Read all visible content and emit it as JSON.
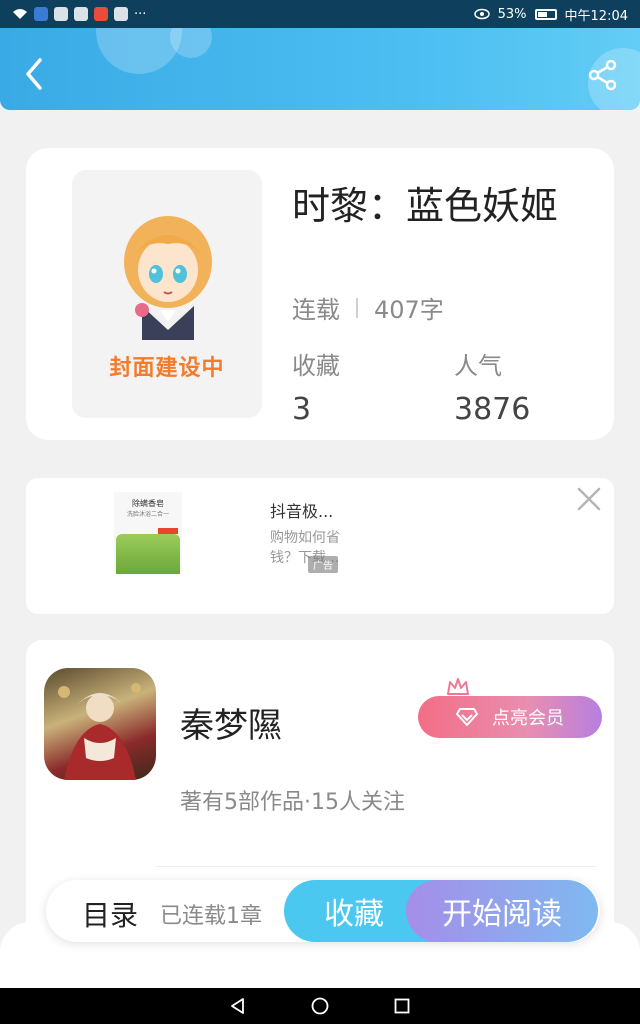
{
  "status_bar": {
    "battery": "53%",
    "time": "中午12:04",
    "more": "···"
  },
  "header": {
    "back_icon": "chevron-left-icon",
    "share_icon": "share-icon"
  },
  "book": {
    "cover_text": "封面建设中",
    "title": "时黎：蓝色妖姬",
    "status": "连载",
    "word_count": "407字",
    "favorites_label": "收藏",
    "favorites_value": "3",
    "popularity_label": "人气",
    "popularity_value": "3876"
  },
  "ad": {
    "image_label": "除螨香皂",
    "image_sub": "洗脸沐浴二合一",
    "title": "抖音极...",
    "description": "购物如何省钱？下载...",
    "badge": "广告",
    "close_icon": "close-icon"
  },
  "author": {
    "name": "秦梦隰",
    "info": "著有5部作品·15人关注",
    "vip_button": "点亮会员",
    "crown_icon": "crown-icon",
    "diamond_icon": "diamond-icon"
  },
  "bottom_bar": {
    "toc_label": "目录",
    "toc_sub": "已连载1章",
    "favorite_button": "收藏",
    "read_button": "开始阅读"
  },
  "colors": {
    "header": "#4ec0f2",
    "favorite_button": "#4bc8ef",
    "cover_text": "#f47b2a",
    "vip_gradient_start": "#f36e86",
    "vip_gradient_end": "#b67fe0"
  }
}
